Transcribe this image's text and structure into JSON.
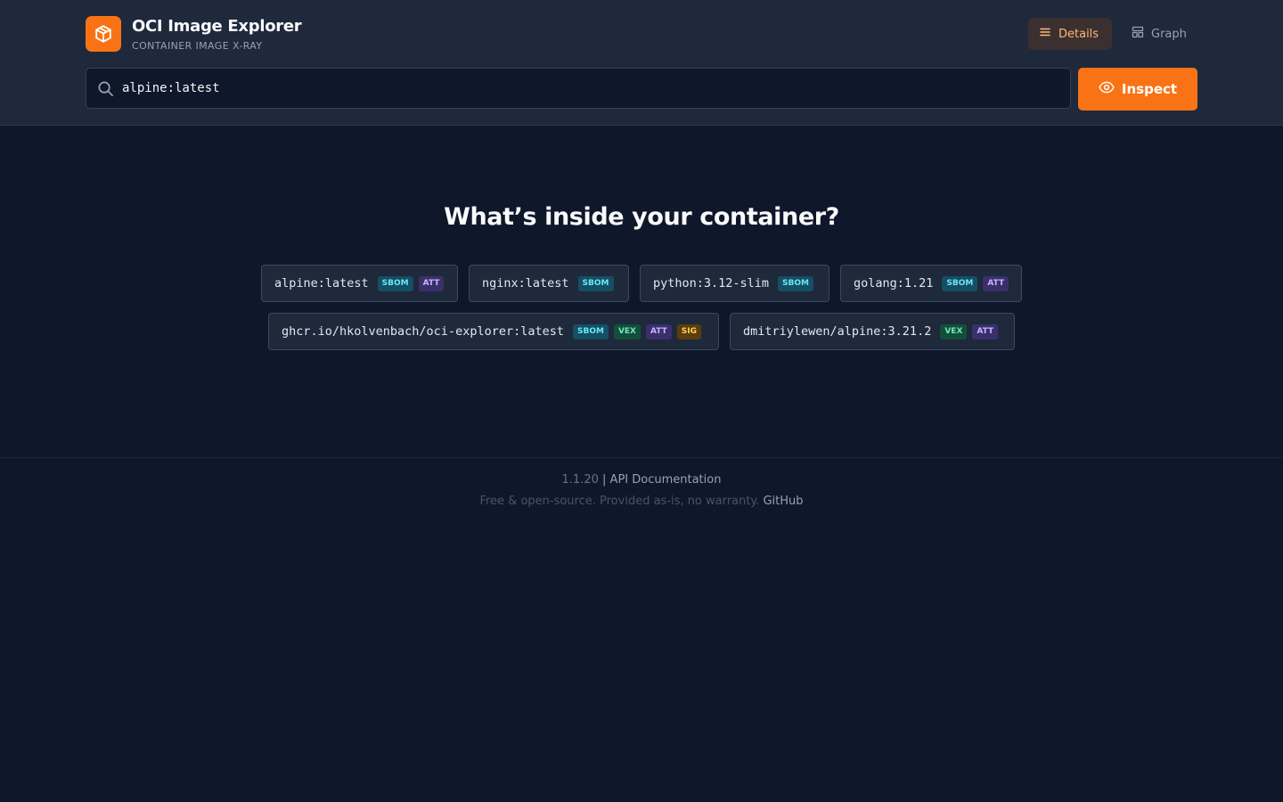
{
  "header": {
    "title": "OCI Image Explorer",
    "subtitle": "CONTAINER IMAGE X-RAY",
    "views": [
      {
        "label": "Details",
        "active": true,
        "icon": "list-icon"
      },
      {
        "label": "Graph",
        "active": false,
        "icon": "graph-icon"
      }
    ]
  },
  "search": {
    "value": "alpine:latest",
    "icon": "search-icon"
  },
  "inspect": {
    "label": "Inspect",
    "icon": "eye-icon"
  },
  "hero": {
    "title": "What’s inside your container?"
  },
  "examples": [
    {
      "name": "alpine:latest",
      "badges": [
        "SBOM",
        "ATT"
      ]
    },
    {
      "name": "nginx:latest",
      "badges": [
        "SBOM"
      ]
    },
    {
      "name": "python:3.12-slim",
      "badges": [
        "SBOM"
      ]
    },
    {
      "name": "golang:1.21",
      "badges": [
        "SBOM",
        "ATT"
      ]
    },
    {
      "name": "ghcr.io/hkolvenbach/oci-explorer:latest",
      "badges": [
        "SBOM",
        "VEX",
        "ATT",
        "SIG"
      ]
    },
    {
      "name": "dmitriylewen/alpine:3.21.2",
      "badges": [
        "VEX",
        "ATT"
      ]
    }
  ],
  "footer": {
    "version": "1.1.20",
    "separator": "|",
    "api_link": "API Documentation",
    "disclaimer": "Free & open-source. Provided as-is, no warranty.",
    "github_link": "GitHub"
  },
  "colors": {
    "accent": "#f97316",
    "background": "#0f172a",
    "header": "#1e293b"
  }
}
